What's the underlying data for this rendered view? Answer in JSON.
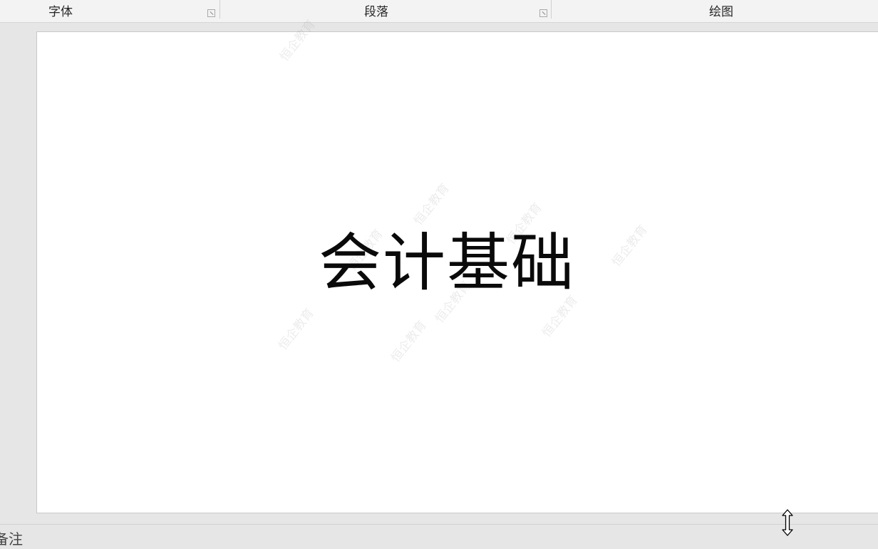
{
  "ribbon": {
    "groups": [
      {
        "label": "字体"
      },
      {
        "label": "段落"
      },
      {
        "label": "绘图"
      }
    ],
    "launcher_icon": "dialog-launcher-icon"
  },
  "slide": {
    "title": "会计基础",
    "watermark_text": "恒企教育"
  },
  "statusbar": {
    "notes_label": "备注"
  },
  "cursor": {
    "icon": "vertical-resize-cursor-icon"
  }
}
